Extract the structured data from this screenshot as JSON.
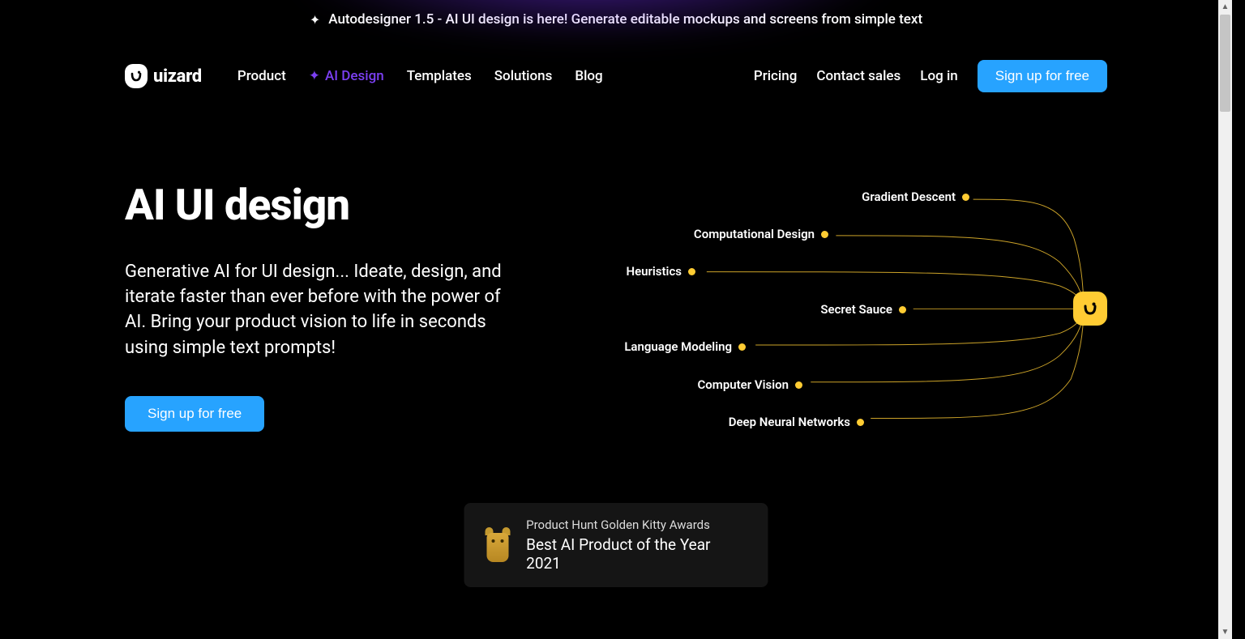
{
  "banner": {
    "text": "Autodesigner 1.5 - AI UI design is here! Generate editable mockups and screens from simple text"
  },
  "brand": {
    "name": "uizard"
  },
  "nav": {
    "items": [
      {
        "label": "Product",
        "active": false
      },
      {
        "label": "AI Design",
        "active": true
      },
      {
        "label": "Templates",
        "active": false
      },
      {
        "label": "Solutions",
        "active": false
      },
      {
        "label": "Blog",
        "active": false
      }
    ],
    "right": {
      "pricing": "Pricing",
      "contact": "Contact sales",
      "login": "Log in",
      "signup": "Sign up for free"
    }
  },
  "hero": {
    "title": "AI UI design",
    "subtitle": "Generative AI for UI design... Ideate, design, and iterate faster than ever before with the power of AI. Bring your product vision to life in seconds using simple text prompts!",
    "cta": "Sign up for free"
  },
  "diagram": {
    "nodes": [
      "Gradient Descent",
      "Computational Design",
      "Heuristics",
      "Secret Sauce",
      "Language Modeling",
      "Computer Vision",
      "Deep Neural Networks"
    ]
  },
  "award": {
    "line1": "Product Hunt Golden Kitty Awards",
    "line2": "Best AI Product of the Year 2021"
  },
  "colors": {
    "accent": "#27a3ff",
    "highlight": "#7b3ff2",
    "gold": "#ffcc33"
  }
}
